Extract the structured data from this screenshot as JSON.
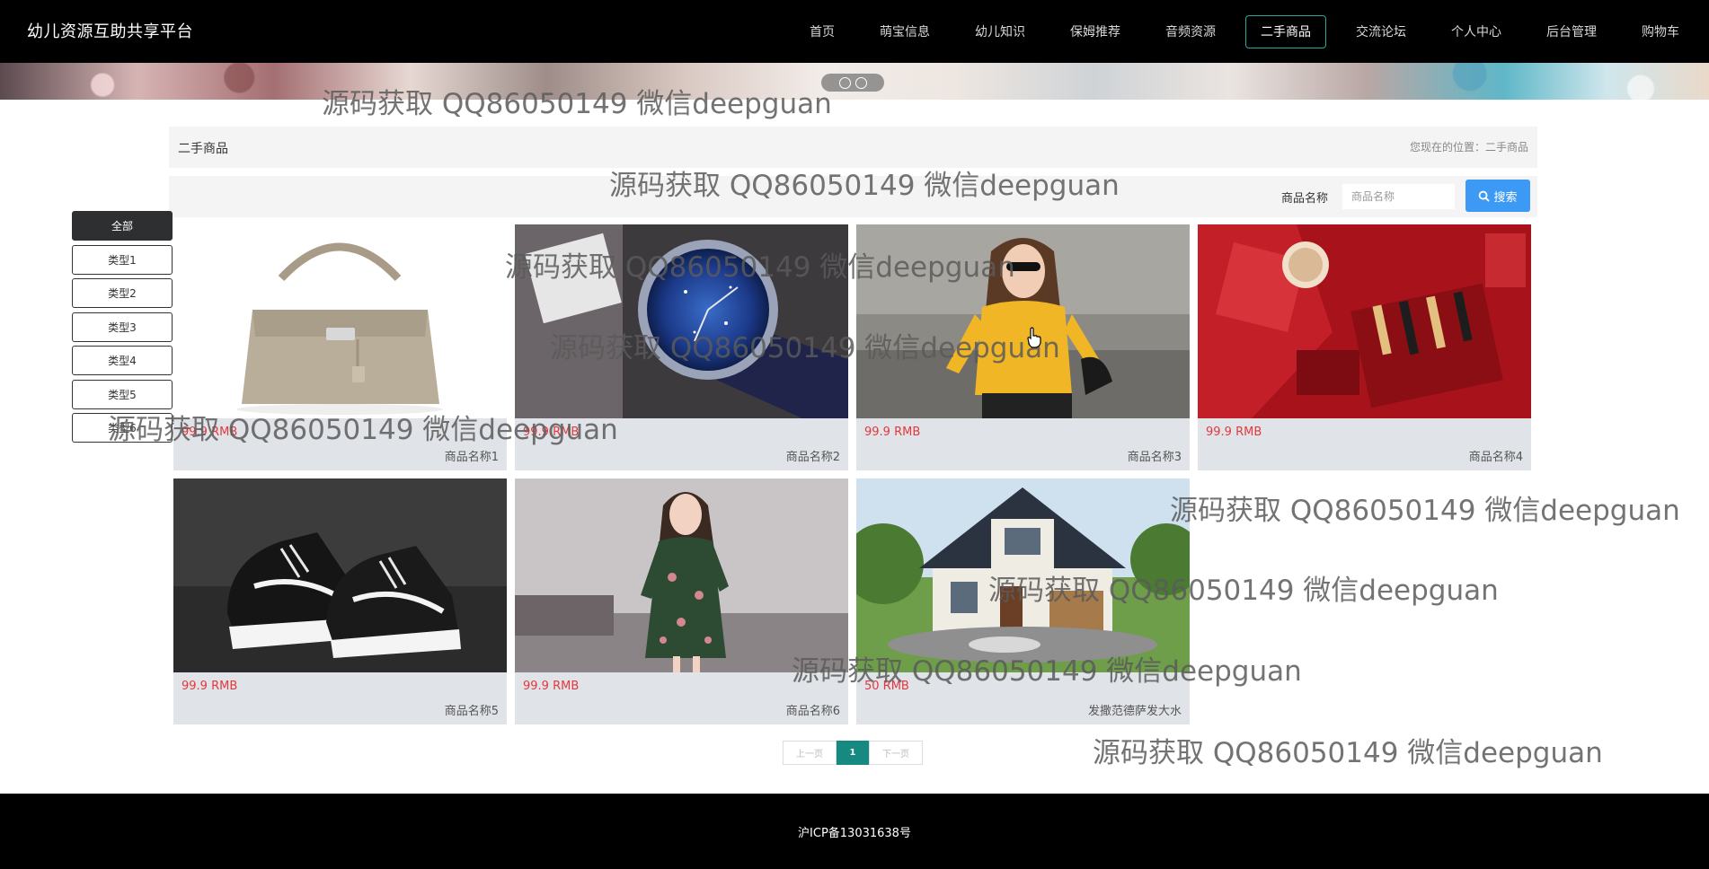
{
  "site": {
    "title": "幼儿资源互助共享平台"
  },
  "nav": {
    "items": [
      {
        "label": "首页"
      },
      {
        "label": "萌宝信息"
      },
      {
        "label": "幼儿知识"
      },
      {
        "label": "保姆推荐"
      },
      {
        "label": "音频资源"
      },
      {
        "label": "二手商品",
        "active": true
      },
      {
        "label": "交流论坛"
      },
      {
        "label": "个人中心"
      },
      {
        "label": "后台管理"
      },
      {
        "label": "购物车"
      }
    ]
  },
  "breadcrumb": {
    "title": "二手商品",
    "location": "您现在的位置：二手商品"
  },
  "search": {
    "label": "商品名称",
    "placeholder": "商品名称",
    "button": "搜索"
  },
  "categories": [
    {
      "label": "全部",
      "active": true
    },
    {
      "label": "类型1"
    },
    {
      "label": "类型2"
    },
    {
      "label": "类型3"
    },
    {
      "label": "类型4"
    },
    {
      "label": "类型5"
    },
    {
      "label": "类型6"
    }
  ],
  "products": [
    {
      "price": "99.9 RMB",
      "name": "商品名称1",
      "image": "handbag"
    },
    {
      "price": "99.9 RMB",
      "name": "商品名称2",
      "image": "watch"
    },
    {
      "price": "99.9 RMB",
      "name": "商品名称3",
      "image": "woman-yellow-top"
    },
    {
      "price": "99.9 RMB",
      "name": "商品名称4",
      "image": "lipstick-giftbox"
    },
    {
      "price": "99.9 RMB",
      "name": "商品名称5",
      "image": "sneakers"
    },
    {
      "price": "99.9 RMB",
      "name": "商品名称6",
      "image": "floral-dress"
    },
    {
      "price": "50 RMB",
      "name": "发撒范德萨发大水",
      "image": "house"
    }
  ],
  "pagination": {
    "prev": "上一页",
    "current": "1",
    "next": "下一页"
  },
  "footer": {
    "icp": "沪ICP备13031638号"
  },
  "watermark": "源码获取 QQ86050149 微信deepguan",
  "colors": {
    "accent": "#168a81",
    "price": "#e2383e",
    "search_button": "#3c99f4"
  }
}
